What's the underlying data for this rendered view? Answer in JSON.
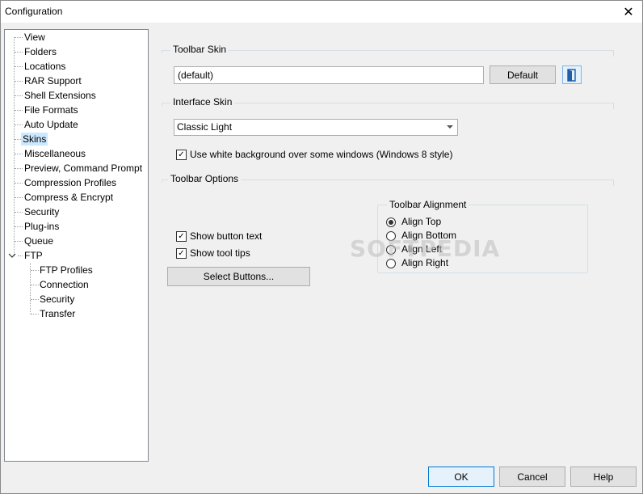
{
  "window": {
    "title": "Configuration",
    "close_glyph": "✕"
  },
  "tree": {
    "items": [
      {
        "label": "View"
      },
      {
        "label": "Folders"
      },
      {
        "label": "Locations"
      },
      {
        "label": "RAR Support"
      },
      {
        "label": "Shell Extensions"
      },
      {
        "label": "File Formats"
      },
      {
        "label": "Auto Update"
      },
      {
        "label": "Skins",
        "selected": true
      },
      {
        "label": "Miscellaneous"
      },
      {
        "label": "Preview, Command Prompt"
      },
      {
        "label": "Compression Profiles"
      },
      {
        "label": "Compress & Encrypt"
      },
      {
        "label": "Security"
      },
      {
        "label": "Plug-ins"
      },
      {
        "label": "Queue"
      },
      {
        "label": "FTP",
        "expanded": true
      }
    ],
    "ftp_children": [
      {
        "label": "FTP Profiles"
      },
      {
        "label": "Connection"
      },
      {
        "label": "Security"
      },
      {
        "label": "Transfer"
      }
    ]
  },
  "toolbar_skin": {
    "heading": "Toolbar Skin",
    "value": "(default)",
    "default_button": "Default",
    "browse_icon": "folder-icon"
  },
  "interface_skin": {
    "heading": "Interface Skin",
    "selected": "Classic Light",
    "white_bg_label": "Use white background over some windows (Windows 8 style)",
    "white_bg_checked": true
  },
  "toolbar_options": {
    "heading": "Toolbar Options",
    "show_button_text_label": "Show button text",
    "show_button_text_checked": true,
    "show_tool_tips_label": "Show tool tips",
    "show_tool_tips_checked": true,
    "select_buttons_label": "Select Buttons...",
    "alignment": {
      "heading": "Toolbar Alignment",
      "options": [
        "Align Top",
        "Align Bottom",
        "Align Left",
        "Align Right"
      ],
      "selected": "Align Top"
    }
  },
  "watermark": "SOFTPEDIA",
  "footer": {
    "ok": "OK",
    "cancel": "Cancel",
    "help": "Help"
  },
  "colors": {
    "accent": "#0078d7",
    "selection": "#cce8ff",
    "background": "#f0f0f0"
  }
}
